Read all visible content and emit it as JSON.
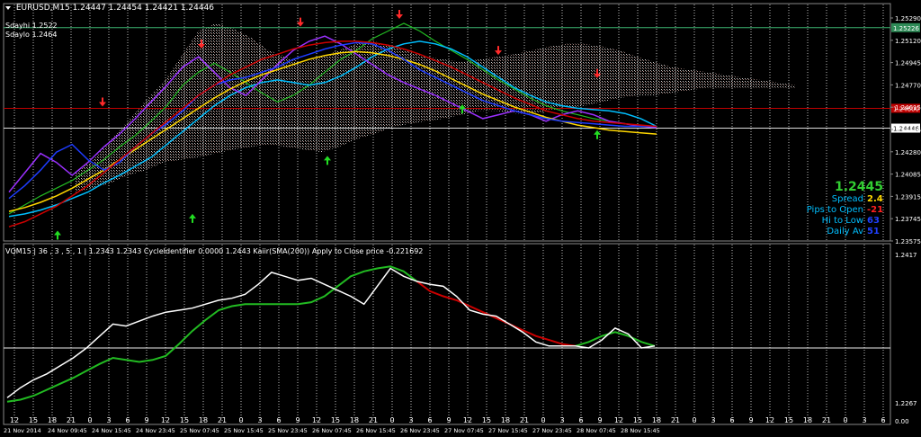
{
  "main_panel": {
    "header_title": "EURUSD,M15  1.24447 1.24454 1.24421 1.24446",
    "sdaily_hi": "Sdayhi 1.2522",
    "sdaily_lo": "Sdaylo 1.2464"
  },
  "info_box": {
    "price": "1.2445",
    "price_color": "#32cd32",
    "rows": [
      {
        "label": "Spread",
        "value": "2.4",
        "color": "#ffd700"
      },
      {
        "label": "Pips to Open",
        "value": "-21",
        "color": "#ff2020"
      },
      {
        "label": "Hi to Low",
        "value": "63",
        "color": "#2040ff"
      },
      {
        "label": "Daily Av",
        "value": "51",
        "color": "#2040ff"
      }
    ],
    "label_color": "#00bfff"
  },
  "lower_panel": {
    "header_title": "VQM15 | 36 , 3 , 5 , 1 | 1.2343 1.2343  CycleIdentifier 0.0000 1.2443  Kaiir(SMA(200)) Apply to Close price -0.221692"
  },
  "chart_data": [
    {
      "panel": "main",
      "type": "line",
      "ylim": [
        1.2357,
        1.2535
      ],
      "y_ticks": [
        "1.25290",
        "1.25120",
        "1.24945",
        "1.24770",
        "1.24615",
        "1.24446",
        "1.24280",
        "1.24085",
        "1.23915",
        "1.23745",
        "1.23575"
      ],
      "price_tags": [
        {
          "text": "1.25226",
          "value": 1.25226,
          "bg": "#2e8b57"
        },
        {
          "text": "1.24600",
          "value": 1.246,
          "bg": "#c00000"
        },
        {
          "text": "1.24446",
          "value": 1.24446,
          "bg": "#ffffff"
        }
      ],
      "hlines": [
        {
          "value": 1.25226,
          "color": "#3cb371"
        },
        {
          "value": 1.246,
          "color": "#c00000"
        },
        {
          "value": 1.24446,
          "color": "#dddddd"
        }
      ],
      "series": [
        {
          "color": "#22bb22",
          "values": [
            1.2378,
            1.2385,
            1.2392,
            1.2398,
            1.2404,
            1.2412,
            1.242,
            1.243,
            1.2439,
            1.245,
            1.2462,
            1.2478,
            1.2488,
            1.2495,
            1.2488,
            1.248,
            1.2472,
            1.2465,
            1.247,
            1.2478,
            1.2488,
            1.2498,
            1.2505,
            1.2514,
            1.252,
            1.2526,
            1.252,
            1.2512,
            1.2505,
            1.2498,
            1.249,
            1.2482,
            1.2475,
            1.2468,
            1.2462,
            1.2458,
            1.2455,
            1.2452,
            1.245,
            1.2448,
            1.2446,
            1.2445
          ]
        },
        {
          "color": "#00bfff",
          "values": [
            1.2376,
            1.2378,
            1.2381,
            1.2385,
            1.239,
            1.2395,
            1.2402,
            1.2408,
            1.2415,
            1.2422,
            1.2432,
            1.2442,
            1.2452,
            1.2462,
            1.247,
            1.2476,
            1.248,
            1.2482,
            1.248,
            1.2478,
            1.248,
            1.2485,
            1.2492,
            1.25,
            1.2506,
            1.251,
            1.2512,
            1.251,
            1.2506,
            1.25,
            1.2492,
            1.2484,
            1.2476,
            1.247,
            1.2465,
            1.2462,
            1.246,
            1.2459,
            1.2458,
            1.2456,
            1.2452,
            1.2446
          ]
        },
        {
          "color": "#9b30ff",
          "values": [
            1.2395,
            1.241,
            1.2425,
            1.2418,
            1.2408,
            1.2418,
            1.243,
            1.244,
            1.2452,
            1.2465,
            1.2478,
            1.2492,
            1.25,
            1.2488,
            1.2476,
            1.247,
            1.2482,
            1.2494,
            1.2505,
            1.2512,
            1.2516,
            1.251,
            1.2502,
            1.2494,
            1.2486,
            1.248,
            1.2475,
            1.247,
            1.2464,
            1.2458,
            1.2452,
            1.2455,
            1.2458,
            1.2455,
            1.245,
            1.2455,
            1.2458,
            1.2455,
            1.245,
            1.2448,
            1.2446,
            1.2445
          ]
        },
        {
          "color": "#ffd700",
          "values": [
            1.238,
            1.2383,
            1.2387,
            1.2392,
            1.2398,
            1.2405,
            1.2412,
            1.242,
            1.2428,
            1.2436,
            1.2444,
            1.2452,
            1.246,
            1.2468,
            1.2475,
            1.2481,
            1.2486,
            1.249,
            1.2494,
            1.2498,
            1.2501,
            1.2503,
            1.2504,
            1.2503,
            1.2501,
            1.2498,
            1.2494,
            1.2489,
            1.2483,
            1.2477,
            1.2471,
            1.2466,
            1.2461,
            1.2457,
            1.2453,
            1.245,
            1.2447,
            1.2445,
            1.2443,
            1.2442,
            1.2441,
            1.244
          ]
        },
        {
          "color": "#1e3cff",
          "values": [
            1.239,
            1.24,
            1.2412,
            1.2426,
            1.2432,
            1.242,
            1.2412,
            1.2418,
            1.243,
            1.244,
            1.2448,
            1.2458,
            1.247,
            1.2478,
            1.2482,
            1.2484,
            1.2488,
            1.2492,
            1.2498,
            1.2502,
            1.2506,
            1.2509,
            1.2511,
            1.251,
            1.2505,
            1.2498,
            1.249,
            1.2484,
            1.2478,
            1.2472,
            1.2466,
            1.2462,
            1.2458,
            1.2455,
            1.2452,
            1.245,
            1.2449,
            1.2448,
            1.2447,
            1.2446,
            1.2446,
            1.2446
          ]
        },
        {
          "color": "#cc0000",
          "values": [
            1.2368,
            1.2372,
            1.2378,
            1.2384,
            1.2392,
            1.24,
            1.241,
            1.242,
            1.243,
            1.244,
            1.245,
            1.246,
            1.247,
            1.2478,
            1.2486,
            1.2492,
            1.2498,
            1.2502,
            1.2506,
            1.2509,
            1.2511,
            1.2512,
            1.2512,
            1.2511,
            1.2509,
            1.2506,
            1.2502,
            1.2497,
            1.2492,
            1.2486,
            1.248,
            1.2474,
            1.2468,
            1.2463,
            1.2458,
            1.2455,
            1.2452,
            1.245,
            1.2449,
            1.2448,
            1.2447,
            1.2446
          ]
        }
      ],
      "cloud": {
        "color": "#c8c8c8",
        "color2": "#c9a098",
        "upper": [
          1.241,
          1.242,
          1.2436,
          1.245,
          1.2466,
          1.248,
          1.25,
          1.252,
          1.2526,
          1.2522,
          1.2515,
          1.2505,
          1.25,
          1.2495,
          1.25,
          1.2505,
          1.251,
          1.2512,
          1.2508,
          1.2504,
          1.25,
          1.2498,
          1.2496,
          1.2498,
          1.25,
          1.2502,
          1.2505,
          1.2508,
          1.251,
          1.251,
          1.2508,
          1.2505,
          1.25,
          1.2496,
          1.2492,
          1.249,
          1.2488,
          1.2486,
          1.2484,
          1.2482,
          1.248,
          1.2478
        ],
        "lower": [
          1.2395,
          1.2398,
          1.2402,
          1.2408,
          1.2412,
          1.2418,
          1.242,
          1.2422,
          1.2425,
          1.2428,
          1.243,
          1.2432,
          1.243,
          1.2428,
          1.2426,
          1.243,
          1.2436,
          1.244,
          1.2445,
          1.2448,
          1.245,
          1.2452,
          1.2455,
          1.2458,
          1.2458,
          1.2456,
          1.2456,
          1.2458,
          1.246,
          1.2462,
          1.2465,
          1.2468,
          1.247,
          1.247,
          1.2472,
          1.2474,
          1.2476,
          1.2476,
          1.2476,
          1.2476,
          1.2476,
          1.2476
        ]
      },
      "up_arrows": [
        1.2372,
        1.2385,
        1.243,
        1.247,
        1.245
      ],
      "down_arrows": [
        1.246,
        1.2505,
        1.2522,
        1.2528,
        1.25,
        1.2482
      ]
    },
    {
      "panel": "lower",
      "type": "line",
      "ylim": [
        1.2262,
        1.2422
      ],
      "y_ticks": [
        "1.2417",
        "1.2267",
        "0.00"
      ],
      "hline": 1.2328,
      "x_labels": [
        "12",
        "15",
        "18",
        "21",
        "0",
        "3",
        "6",
        "9",
        "12",
        "15",
        "18",
        "21",
        "0",
        "3",
        "6",
        "9",
        "12",
        "15",
        "18",
        "21",
        "0",
        "3",
        "6",
        "9",
        "12",
        "15",
        "18",
        "21",
        "0",
        "3",
        "6",
        "9",
        "12",
        "15",
        "18",
        "21",
        "0",
        "3",
        "6",
        "9",
        "12",
        "15",
        "18",
        "21",
        "0",
        "3",
        "6"
      ],
      "date_labels": [
        "21 Nov 2014",
        "24 Nov 09:45",
        "24 Nov 15:45",
        "24 Nov 23:45",
        "25 Nov 07:45",
        "25 Nov 15:45",
        "25 Nov 23:45",
        "26 Nov 07:45",
        "26 Nov 15:45",
        "26 Nov 23:45",
        "27 Nov 07:45",
        "27 Nov 15:45",
        "27 Nov 23:45",
        "28 Nov 07:45",
        "28 Nov 15:45"
      ],
      "series": [
        {
          "name": "",
          "color": "#ffffff",
          "values": [
            1.2278,
            1.2288,
            1.2296,
            1.2302,
            1.231,
            1.2318,
            1.2328,
            1.234,
            1.2352,
            1.235,
            1.2355,
            1.236,
            1.2364,
            1.2366,
            1.2368,
            1.2372,
            1.2376,
            1.2378,
            1.2382,
            1.2392,
            1.2404,
            1.24,
            1.2396,
            1.2398,
            1.2392,
            1.2386,
            1.238,
            1.2372,
            1.239,
            1.2408,
            1.24,
            1.2395,
            1.2392,
            1.239,
            1.238,
            1.2366,
            1.2362,
            1.236,
            1.2352,
            1.2344,
            1.2334,
            1.233,
            1.233,
            1.233,
            1.2328,
            1.2336,
            1.2348,
            1.2342,
            1.2328,
            1.233
          ]
        },
        {
          "name": "",
          "color": "#22bb22",
          "values": [
            1.2274,
            1.2276,
            1.228,
            1.2286,
            1.2292,
            1.2298,
            1.2305,
            1.2312,
            1.2318,
            1.2316,
            1.2314,
            1.2316,
            1.232,
            1.2332,
            1.2345,
            1.2356,
            1.2366,
            1.237,
            1.2372,
            1.2372,
            1.2372,
            1.2372,
            1.2372,
            1.2374,
            1.238,
            1.239,
            1.24,
            1.2405,
            1.2408,
            1.241,
            1.2405,
            1.2395,
            1.2385,
            1.238,
            1.2376,
            1.237,
            1.2364,
            1.2358,
            1.2352,
            1.2346,
            1.234,
            1.2336,
            1.2332,
            1.233,
            1.2334,
            1.234,
            1.2344,
            1.234,
            1.2334,
            1.233
          ]
        },
        {
          "name": "",
          "color": "#cc0000",
          "values": [
            1.2274,
            1.2276,
            1.228,
            1.2286,
            1.2292,
            1.2298,
            1.2305,
            1.2312,
            1.2318,
            1.2316,
            1.2314,
            1.2316,
            1.232,
            1.2332,
            1.2345,
            1.2356,
            1.2366,
            1.237,
            1.2372,
            1.2372,
            1.2372,
            1.2372,
            1.2372,
            1.2374,
            1.238,
            1.239,
            1.24,
            1.2405,
            1.2408,
            1.241,
            1.2405,
            1.2395,
            1.2385,
            1.238,
            1.2376,
            1.237,
            1.2364,
            1.2358,
            1.2352,
            1.2346,
            1.234,
            1.2336,
            1.2332,
            1.233,
            1.2334,
            1.234,
            1.2344,
            1.234,
            1.2334,
            1.233
          ]
        }
      ]
    }
  ]
}
